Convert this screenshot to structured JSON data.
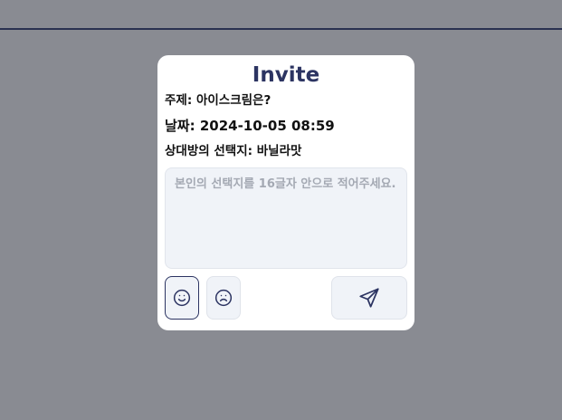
{
  "modal": {
    "title": "Invite",
    "topic": "주제: 아이스크림은?",
    "date": "날짜: 2024-10-05 08:59",
    "opponent_choice": "상대방의 선택지: 바닐라맛",
    "input": {
      "placeholder": "본인의 선택지를 16글자 안으로 적어주세요.",
      "value": ""
    },
    "buttons": {
      "like_icon": "smile-icon",
      "dislike_icon": "frown-icon",
      "send_icon": "send-icon"
    }
  },
  "colors": {
    "backdrop": "#898b92",
    "accent": "#2c3462",
    "input_bg": "#f0f3f8"
  }
}
